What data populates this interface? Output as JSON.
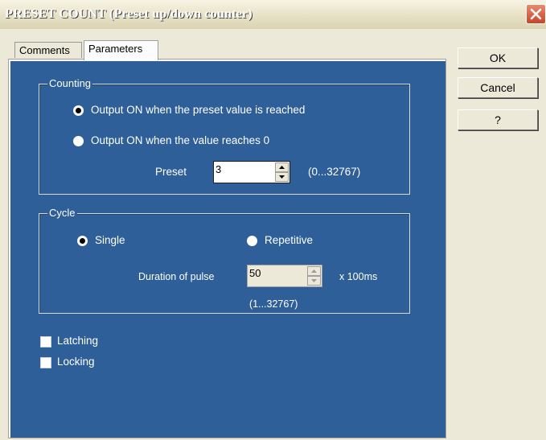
{
  "window": {
    "title": "PRESET COUNT (Preset up/down counter)"
  },
  "tabs": [
    {
      "label": "Comments"
    },
    {
      "label": "Parameters"
    }
  ],
  "buttons": {
    "ok": "OK",
    "cancel": "Cancel",
    "help": "?"
  },
  "counting": {
    "title": "Counting",
    "option1": "Output ON when the preset value is reached",
    "option2": "Output ON when the value reaches 0",
    "selected": "option1",
    "preset_label": "Preset",
    "preset_value": "3",
    "preset_range": "(0...32767)"
  },
  "cycle": {
    "title": "Cycle",
    "single_label": "Single",
    "repetitive_label": "Repetitive",
    "selected": "single",
    "duration_label": "Duration of pulse",
    "duration_value": "50",
    "duration_unit": "x 100ms",
    "duration_range": "(1...32767)"
  },
  "options": {
    "latching_label": "Latching",
    "latching_checked": false,
    "locking_label": "Locking",
    "locking_checked": false
  },
  "colors": {
    "panel_bg": "#2e5f98",
    "dialog_bg": "#ece9d8",
    "close_button": "#c8452a"
  },
  "icons": {
    "close": "close-x-icon",
    "spin_up": "triangle-up-icon",
    "spin_down": "triangle-down-icon"
  }
}
